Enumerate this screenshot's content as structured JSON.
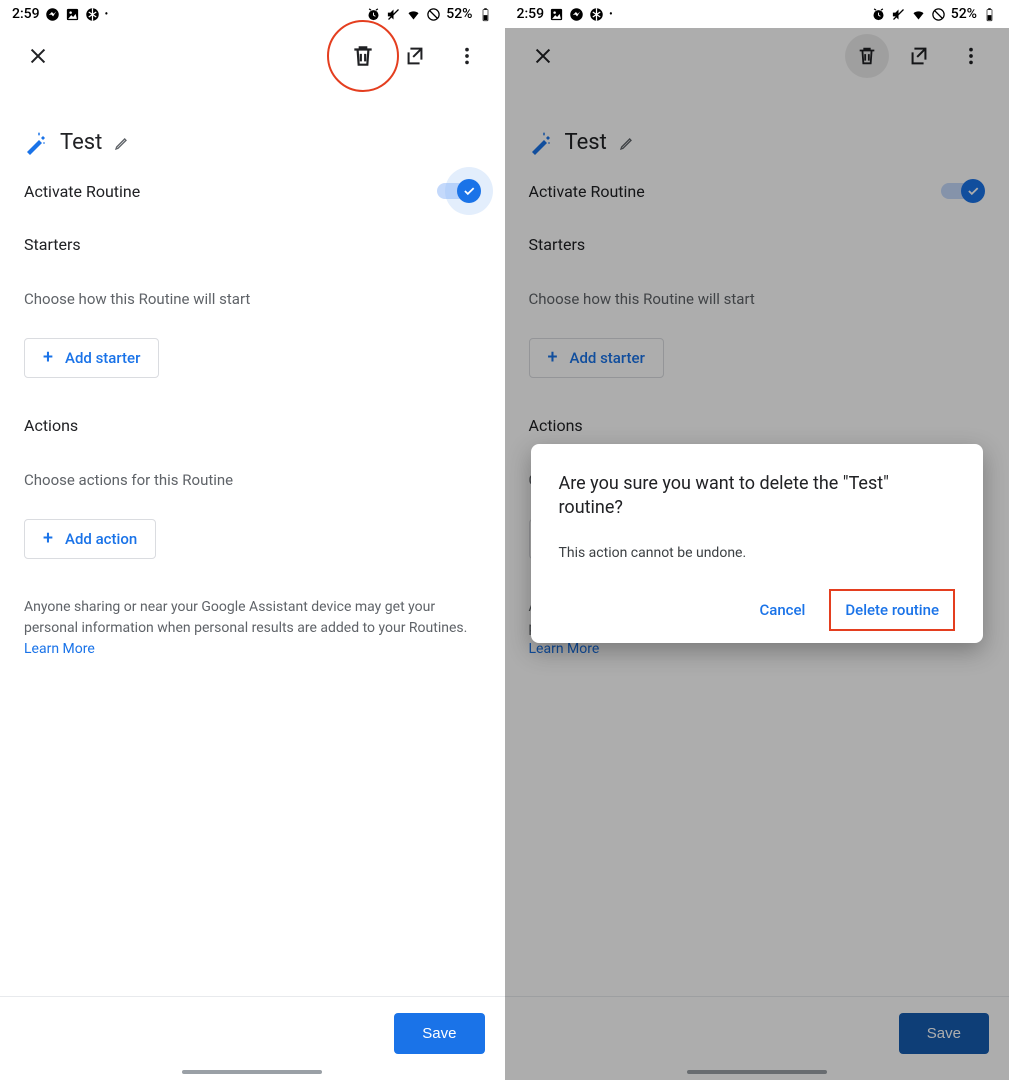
{
  "status_bar": {
    "time": "2:59",
    "battery_text": "52%"
  },
  "app_bar": {},
  "routine": {
    "title": "Test",
    "activate_label": "Activate Routine"
  },
  "starters": {
    "title": "Starters",
    "subtitle": "Choose how this Routine will start",
    "add_label": "Add starter"
  },
  "actions": {
    "title": "Actions",
    "subtitle": "Choose actions for this Routine",
    "add_label": "Add action"
  },
  "footer": {
    "text": "Anyone sharing or near your Google Assistant device may get your personal information when personal results are added to your Routines. ",
    "link": "Learn More"
  },
  "save_label": "Save",
  "dialog": {
    "title": "Are you sure you want to delete the \"Test\" routine?",
    "body": "This action cannot be undone.",
    "cancel": "Cancel",
    "confirm": "Delete routine"
  }
}
